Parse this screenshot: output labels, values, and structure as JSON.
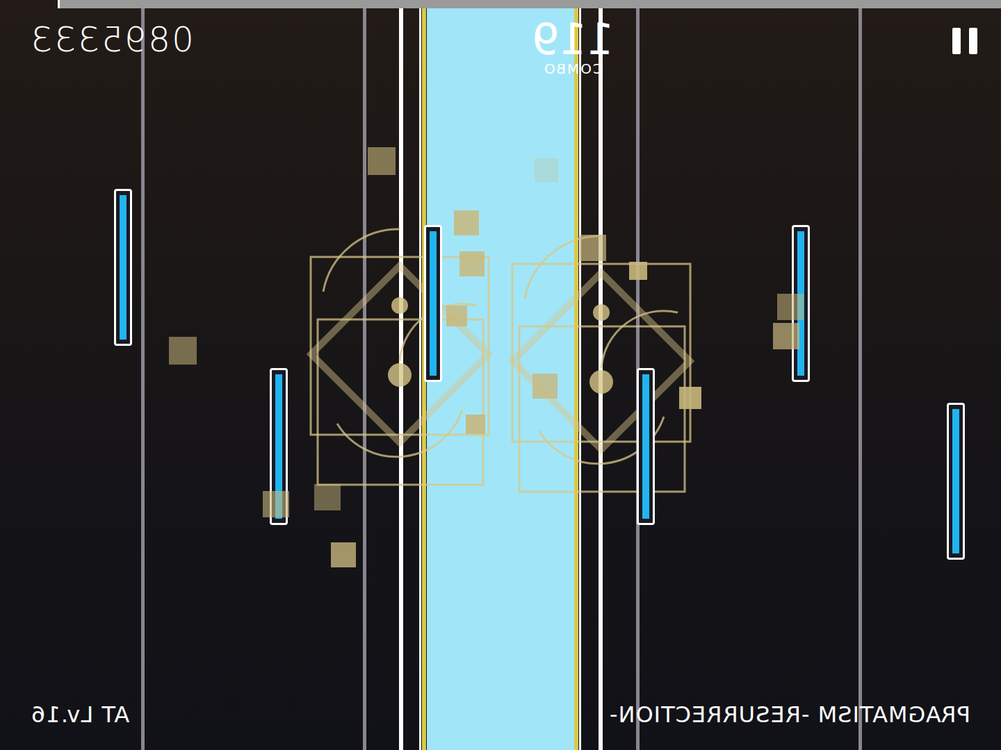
{
  "hud": {
    "score": "0895333",
    "combo": "119",
    "combo_label": "COMBO",
    "difficulty": "AT Lv.16",
    "song": "PRAGMATISM -RESURRECTION-",
    "progress": {
      "level": 0.94
    }
  },
  "controls": {
    "pause": "paused_off"
  }
}
